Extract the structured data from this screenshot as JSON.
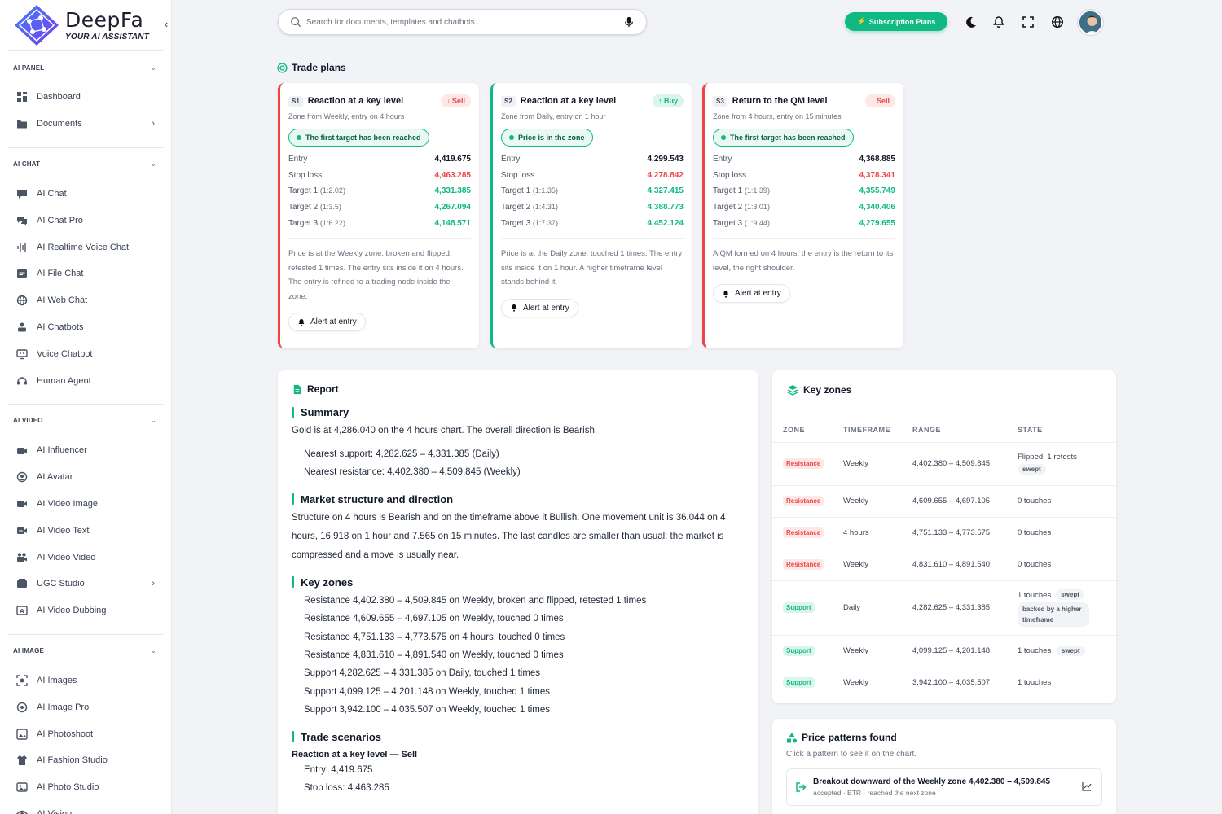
{
  "brand": {
    "name": "DeepFa",
    "tagline": "YOUR AI ASSISTANT"
  },
  "sidebar": {
    "sections": [
      {
        "title": "AI PANEL",
        "items": [
          {
            "label": "Dashboard",
            "icon": "dashboard-icon"
          },
          {
            "label": "Documents",
            "icon": "folder-icon",
            "arrow": true
          }
        ]
      },
      {
        "title": "AI CHAT",
        "items": [
          {
            "label": "AI Chat",
            "icon": "chat-icon"
          },
          {
            "label": "AI Chat Pro",
            "icon": "chat-pro-icon"
          },
          {
            "label": "AI Realtime Voice Chat",
            "icon": "voice-wave-icon"
          },
          {
            "label": "AI File Chat",
            "icon": "file-chat-icon"
          },
          {
            "label": "AI Web Chat",
            "icon": "globe-icon"
          },
          {
            "label": "AI Chatbots",
            "icon": "bot-icon"
          },
          {
            "label": "Voice Chatbot",
            "icon": "voice-bot-icon"
          },
          {
            "label": "Human Agent",
            "icon": "headset-icon"
          }
        ]
      },
      {
        "title": "AI VIDEO",
        "items": [
          {
            "label": "AI Influencer",
            "icon": "influencer-icon"
          },
          {
            "label": "AI Avatar",
            "icon": "avatar-icon"
          },
          {
            "label": "AI Video Image",
            "icon": "video-icon"
          },
          {
            "label": "AI Video Text",
            "icon": "video-text-icon"
          },
          {
            "label": "AI Video Video",
            "icon": "camera-icon"
          },
          {
            "label": "UGC Studio",
            "icon": "studio-icon",
            "arrow": true
          },
          {
            "label": "AI Video Dubbing",
            "icon": "dubbing-icon"
          }
        ]
      },
      {
        "title": "AI IMAGE",
        "items": [
          {
            "label": "AI Images",
            "icon": "image-scan-icon"
          },
          {
            "label": "AI Image Pro",
            "icon": "image-pro-icon"
          },
          {
            "label": "AI Photoshoot",
            "icon": "photoshoot-icon"
          },
          {
            "label": "AI Fashion Studio",
            "icon": "shirt-icon"
          },
          {
            "label": "AI Photo Studio",
            "icon": "photo-icon"
          },
          {
            "label": "AI Vision",
            "icon": "eye-icon"
          }
        ]
      }
    ]
  },
  "topbar": {
    "search_placeholder": "Search for documents, templates and chatbots...",
    "subscription_label": "Subscription Plans"
  },
  "trade_plans": {
    "title": "Trade plans",
    "cards": [
      {
        "id": "S1",
        "title": "Reaction at a key level",
        "direction": "Sell",
        "dir_class": "sell",
        "subtitle": "Zone from Weekly, entry on 4 hours",
        "status": "The first target has been reached",
        "entry": "4,419.675",
        "stop": "4,463.285",
        "targets": [
          {
            "label": "Target 1",
            "ratio": "(1:2.02)",
            "value": "4,331.385"
          },
          {
            "label": "Target 2",
            "ratio": "(1:3.5)",
            "value": "4,267.094"
          },
          {
            "label": "Target 3",
            "ratio": "(1:6.22)",
            "value": "4,148.571"
          }
        ],
        "desc": "Price is at the Weekly zone, broken and flipped, retested 1 times. The entry sits inside it on 4 hours. The entry is refined to a trading node inside the zone.",
        "alert": "Alert at entry"
      },
      {
        "id": "S2",
        "title": "Reaction at a key level",
        "direction": "Buy",
        "dir_class": "buy",
        "subtitle": "Zone from Daily, entry on 1 hour",
        "status": "Price is in the zone",
        "entry": "4,299.543",
        "stop": "4,278.842",
        "targets": [
          {
            "label": "Target 1",
            "ratio": "(1:1.35)",
            "value": "4,327.415"
          },
          {
            "label": "Target 2",
            "ratio": "(1:4.31)",
            "value": "4,388.773"
          },
          {
            "label": "Target 3",
            "ratio": "(1:7.37)",
            "value": "4,452.124"
          }
        ],
        "desc": "Price is at the Daily zone, touched 1 times. The entry sits inside it on 1 hour. A higher timeframe level stands behind it.",
        "alert": "Alert at entry"
      },
      {
        "id": "S3",
        "title": "Return to the QM level",
        "direction": "Sell",
        "dir_class": "sell",
        "subtitle": "Zone from 4 hours, entry on 15 minutes",
        "status": "The first target has been reached",
        "entry": "4,368.885",
        "stop": "4,378.341",
        "targets": [
          {
            "label": "Target 1",
            "ratio": "(1:1.39)",
            "value": "4,355.749"
          },
          {
            "label": "Target 2",
            "ratio": "(1:3.01)",
            "value": "4,340.406"
          },
          {
            "label": "Target 3",
            "ratio": "(1:9.44)",
            "value": "4,279.655"
          }
        ],
        "desc": "A QM formed on 4 hours; the entry is the return to its level, the right shoulder.",
        "alert": "Alert at entry"
      }
    ],
    "entry_label": "Entry",
    "stop_label": "Stop loss"
  },
  "report": {
    "title": "Report",
    "summary_title": "Summary",
    "summary_text": "Gold is at 4,286.040 on the 4 hours chart. The overall direction is Bearish.",
    "summary_items": [
      "Nearest support: 4,282.625 – 4,331.385 (Daily)",
      "Nearest resistance: 4,402.380 – 4,509.845 (Weekly)"
    ],
    "structure_title": "Market structure and direction",
    "structure_text": "Structure on 4 hours is Bearish and on the timeframe above it Bullish. One movement unit is 36.044 on 4 hours, 16.918 on 1 hour and 7.565 on 15 minutes. The last candles are smaller than usual: the market is compressed and a move is usually near.",
    "zones_title": "Key zones",
    "zones_items": [
      "Resistance 4,402.380 – 4,509.845 on Weekly, broken and flipped, retested 1 times",
      "Resistance 4,609.655 – 4,697.105 on Weekly, touched 0 times",
      "Resistance 4,751.133 – 4,773.575 on 4 hours, touched 0 times",
      "Resistance 4,831.610 – 4,891.540 on Weekly, touched 0 times",
      "Support 4,282.625 – 4,331.385 on Daily, touched 1 times",
      "Support 4,099.125 – 4,201.148 on Weekly, touched 1 times",
      "Support 3,942.100 – 4,035.507 on Weekly, touched 1 times"
    ],
    "scenarios_title": "Trade scenarios",
    "scenario_head": "Reaction at a key level — Sell",
    "scenario_items": [
      "Entry: 4,419.675",
      "Stop loss: 4,463.285"
    ]
  },
  "key_zones": {
    "title": "Key zones",
    "columns": [
      "ZONE",
      "TIMEFRAME",
      "RANGE",
      "STATE"
    ],
    "rows": [
      {
        "zone": "Resistance",
        "cls": "res",
        "tf": "Weekly",
        "range": "4,402.380 – 4,509.845",
        "state": "Flipped, 1 retests",
        "tags": [
          "swept"
        ],
        "tag_below": true
      },
      {
        "zone": "Resistance",
        "cls": "res",
        "tf": "Weekly",
        "range": "4,609.655 – 4,697.105",
        "state": "0 touches",
        "tags": []
      },
      {
        "zone": "Resistance",
        "cls": "res",
        "tf": "4 hours",
        "range": "4,751.133 – 4,773.575",
        "state": "0 touches",
        "tags": []
      },
      {
        "zone": "Resistance",
        "cls": "res",
        "tf": "Weekly",
        "range": "4,831.610 – 4,891.540",
        "state": "0 touches",
        "tags": []
      },
      {
        "zone": "Support",
        "cls": "sup",
        "tf": "Daily",
        "range": "4,282.625 – 4,331.385",
        "state": "1 touches",
        "tags": [
          "swept",
          "backed by a higher timeframe"
        ]
      },
      {
        "zone": "Support",
        "cls": "sup",
        "tf": "Weekly",
        "range": "4,099.125 – 4,201.148",
        "state": "1 touches",
        "tags": [
          "swept"
        ]
      },
      {
        "zone": "Support",
        "cls": "sup",
        "tf": "Weekly",
        "range": "3,942.100 – 4,035.507",
        "state": "1 touches",
        "tags": []
      }
    ]
  },
  "patterns": {
    "title": "Price patterns found",
    "subtitle": "Click a pattern to see it on the chart.",
    "items": [
      {
        "title": "Breakout downward of the Weekly zone 4,402.380 – 4,509.845",
        "meta": "accepted · ETR · reached the next zone"
      }
    ]
  },
  "colors": {
    "accent": "#10b981",
    "sell": "#ef4444",
    "buy": "#10b981"
  }
}
